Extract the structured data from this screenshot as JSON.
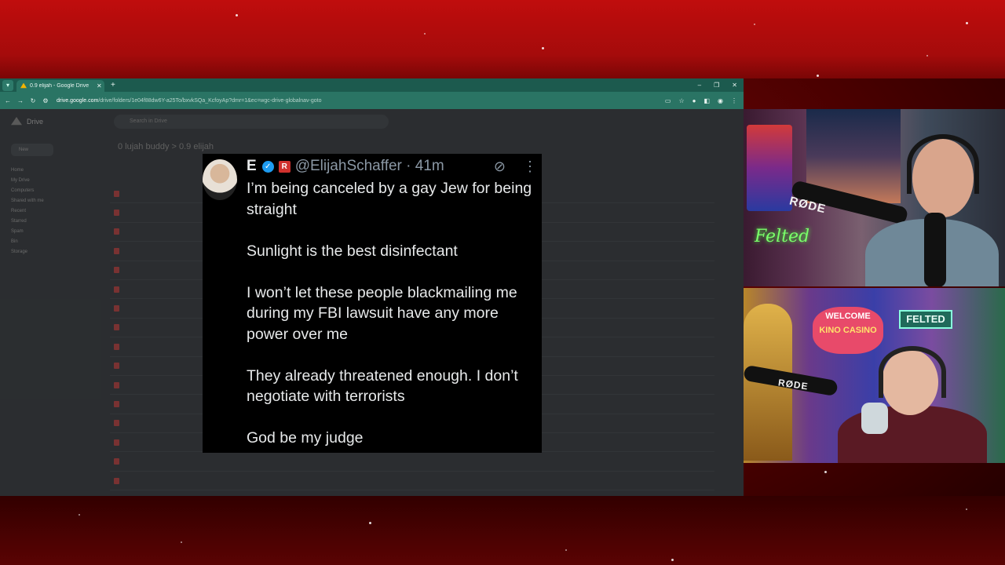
{
  "browser": {
    "tab_title": "0.9 elijah - Google Drive",
    "url_host": "drive.google.com",
    "url_path": "/drive/folders/1e04f88dw6Y-a25To/bxvkSQa_KcfoyAp?dmr=1&ec=wgc-drive-globalnav-goto"
  },
  "drive": {
    "app_name": "Drive",
    "search_placeholder": "Search in Drive",
    "breadcrumb": "0 lujah buddy  >  0.9 elijah",
    "new_label": "New",
    "sidebar": [
      "Home",
      "My Drive",
      "Computers",
      "Shared with me",
      "Recent",
      "Starred",
      "Spam",
      "Bin",
      "Storage"
    ],
    "rows": [
      "",
      "",
      "",
      "",
      "",
      "",
      "",
      "",
      "",
      "",
      "",
      "",
      "",
      "",
      "",
      ""
    ]
  },
  "tweet": {
    "name": "E",
    "handle": "@ElijahSchaffer · 41m",
    "paragraphs": [
      "I’m being canceled by a gay Jew for being straight",
      "Sunlight is the best disinfectant",
      "I won’t let these people blackmailing me during my FBI lawsuit have any more power over me",
      "They already threatened enough. I don’t negotiate with terrorists",
      "God be my judge"
    ]
  },
  "cam1": {
    "mic_brand": "RØDE",
    "neon_sign": "Felted"
  },
  "cam2": {
    "mic_brand": "RØDE",
    "welcome": "WELCOME",
    "casino": "KINO CASINO",
    "felted": "FELTED"
  }
}
